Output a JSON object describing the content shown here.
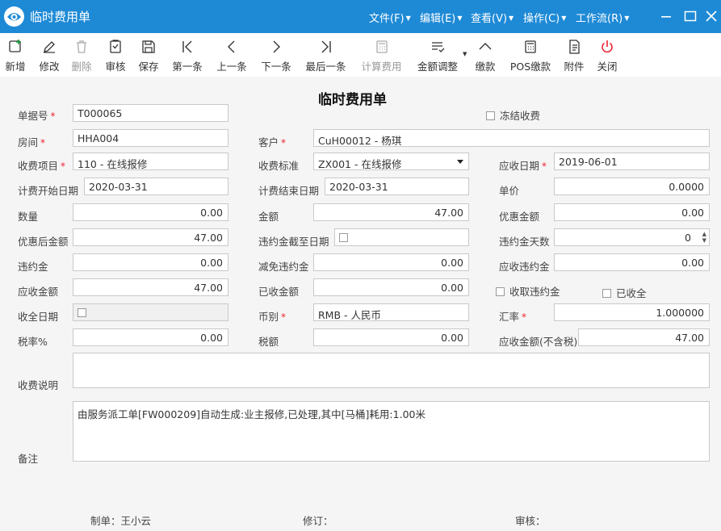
{
  "window": {
    "title": "临时费用单"
  },
  "menu": [
    {
      "id": "file",
      "label": "文件(F)"
    },
    {
      "id": "edit",
      "label": "编辑(E)"
    },
    {
      "id": "view",
      "label": "查看(V)"
    },
    {
      "id": "op",
      "label": "操作(C)"
    },
    {
      "id": "wf",
      "label": "工作流(R)"
    }
  ],
  "toolbar": [
    {
      "id": "new",
      "label": "新增",
      "icon": "add-document-icon",
      "enabled": true
    },
    {
      "id": "edit",
      "label": "修改",
      "icon": "pencil-icon",
      "enabled": true
    },
    {
      "id": "delete",
      "label": "删除",
      "icon": "trash-icon",
      "enabled": false
    },
    {
      "id": "audit",
      "label": "审核",
      "icon": "audit-clipboard-icon",
      "enabled": true
    },
    {
      "id": "save",
      "label": "保存",
      "icon": "floppy-disk-icon",
      "enabled": true
    },
    {
      "id": "first",
      "label": "第一条",
      "icon": "first-record-icon",
      "enabled": true
    },
    {
      "id": "prev",
      "label": "上一条",
      "icon": "previous-icon",
      "enabled": true
    },
    {
      "id": "next",
      "label": "下一条",
      "icon": "next-icon",
      "enabled": true
    },
    {
      "id": "last",
      "label": "最后一条",
      "icon": "last-record-icon",
      "enabled": true
    },
    {
      "id": "calc",
      "label": "计算费用",
      "icon": "calculator-icon",
      "enabled": false
    },
    {
      "id": "adjust",
      "label": "金额调整",
      "icon": "adjust-list-icon",
      "enabled": true
    },
    {
      "id": "pay",
      "label": "缴款",
      "icon": "chevron-up-icon",
      "enabled": true
    },
    {
      "id": "pos",
      "label": "POS缴款",
      "icon": "pos-calculator-icon",
      "enabled": true
    },
    {
      "id": "attach",
      "label": "附件",
      "icon": "attachment-document-icon",
      "enabled": true
    },
    {
      "id": "close",
      "label": "关闭",
      "icon": "power-icon",
      "enabled": true
    }
  ],
  "form": {
    "title": "临时费用单",
    "bill_no": {
      "label": "单据号",
      "value": "T000065"
    },
    "freeze": {
      "label": "冻结收费",
      "checked": false
    },
    "room": {
      "label": "房间",
      "value": "HHA004"
    },
    "customer": {
      "label": "客户",
      "value": "CuH00012 - 杨琪"
    },
    "item": {
      "label": "收费项目",
      "value": "110 - 在线报修"
    },
    "standard": {
      "label": "收费标准",
      "value": "ZX001 - 在线报修"
    },
    "due_date": {
      "label": "应收日期",
      "value": "2019-06-01"
    },
    "start_date": {
      "label": "计费开始日期",
      "value": "2020-03-31"
    },
    "end_date": {
      "label": "计费结束日期",
      "value": "2020-03-31"
    },
    "unit_price": {
      "label": "单价",
      "value": "0.0000"
    },
    "quantity": {
      "label": "数量",
      "value": "0.00"
    },
    "amount": {
      "label": "金额",
      "value": "47.00"
    },
    "discount": {
      "label": "优惠金额",
      "value": "0.00"
    },
    "after_discount": {
      "label": "优惠后金额",
      "value": "47.00"
    },
    "penalty_to": {
      "label": "违约金截至日期",
      "checked": false
    },
    "penalty_days": {
      "label": "违约金天数",
      "value": "0"
    },
    "penalty": {
      "label": "违约金",
      "value": "0.00"
    },
    "penalty_waive": {
      "label": "减免违约金",
      "value": "0.00"
    },
    "penalty_due": {
      "label": "应收违约金",
      "value": "0.00"
    },
    "receivable": {
      "label": "应收金额",
      "value": "47.00"
    },
    "received": {
      "label": "已收金额",
      "value": "0.00"
    },
    "collect_penalty": {
      "label": "收取违约金",
      "checked": false
    },
    "fully_paid": {
      "label": "已收全",
      "checked": false
    },
    "paid_date": {
      "label": "收全日期",
      "checked": false
    },
    "currency": {
      "label": "币别",
      "value": "RMB - 人民币"
    },
    "rate": {
      "label": "汇率",
      "value": "1.000000"
    },
    "tax_rate": {
      "label": "税率%",
      "value": "0.00"
    },
    "tax": {
      "label": "税额",
      "value": "0.00"
    },
    "receivable_ex_tax": {
      "label": "应收金额(不含税)",
      "value": "47.00"
    },
    "desc": {
      "label": "收费说明",
      "value": ""
    },
    "remark": {
      "label": "备注",
      "value": "由服务派工单[FW000209]自动生成:业主报修,已处理,其中[马桶]耗用:1.00米"
    }
  },
  "footer": {
    "maker": "制单：王小云",
    "revise": "修订：",
    "auditor": "审核："
  },
  "colors": {
    "titlebar": "#1e8ad6",
    "required": "#e23",
    "close": "#e23"
  }
}
